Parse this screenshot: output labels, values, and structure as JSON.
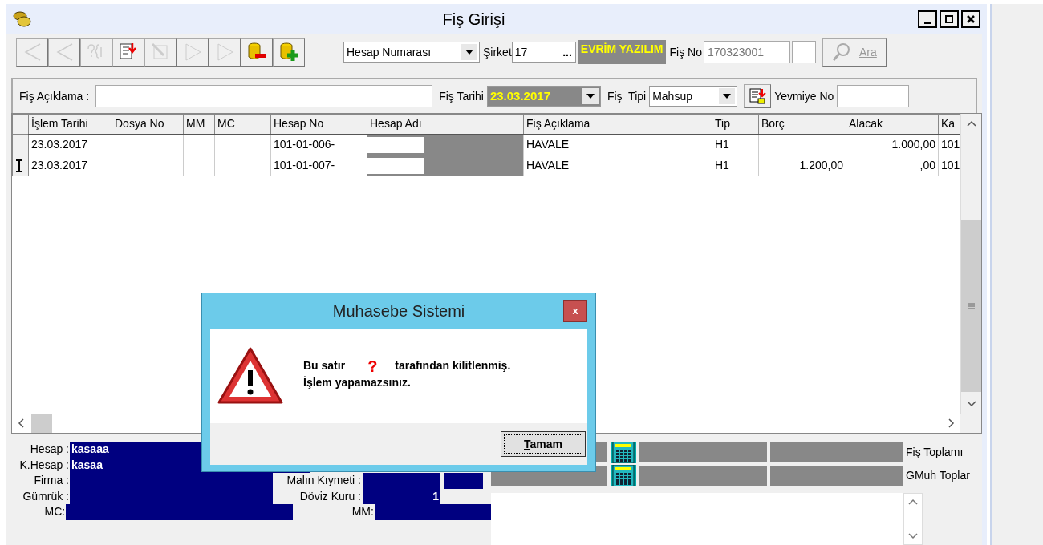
{
  "window": {
    "title": "Fiş Girişi"
  },
  "toolbar": [
    {
      "kind": "first",
      "disabled": true
    },
    {
      "kind": "prev",
      "disabled": true
    },
    {
      "kind": "query",
      "disabled": true
    },
    {
      "kind": "import",
      "disabled": false
    },
    {
      "kind": "edit",
      "disabled": true
    },
    {
      "kind": "next",
      "disabled": true
    },
    {
      "kind": "last",
      "disabled": true
    },
    {
      "kind": "remove",
      "disabled": false
    },
    {
      "kind": "add",
      "disabled": false
    }
  ],
  "search_by": {
    "value": "Hesap Numarası"
  },
  "company": {
    "label": "Şirket",
    "value": "17",
    "browse": "...",
    "name": "EVRİM YAZILIM"
  },
  "voucher_no": {
    "label": "Fiş No",
    "value": "170323001",
    "search_button": "Ara"
  },
  "description": {
    "label": "Fiş Açıklama :"
  },
  "date": {
    "label": "Fiş Tarihi",
    "value": "23.03.2017"
  },
  "type": {
    "label": "Fiş  Tipi",
    "value": "Mahsup"
  },
  "journal_no": {
    "label": "Yevmiye No"
  },
  "table": {
    "columns": [
      "İşlem Tarihi",
      "Dosya No",
      "MM",
      "MC",
      "Hesap No",
      "Hesap Adı",
      "Fiş Açıklama",
      "Tip",
      "Borç",
      "Alacak",
      "Ka"
    ],
    "rows": [
      {
        "selected": false,
        "cells": [
          "23.03.2017",
          "",
          "",
          "",
          "101-01-006-",
          "",
          "HAVALE",
          "H1",
          "",
          "1.000,00",
          "101"
        ]
      },
      {
        "selected": true,
        "cells": [
          "23.03.2017",
          "",
          "",
          "",
          "101-01-007-",
          "",
          "HAVALE",
          "H1",
          "1.200,00",
          ",00",
          "101"
        ]
      }
    ]
  },
  "info_left": [
    {
      "label": "Hesap :",
      "value": "kasaaa"
    },
    {
      "label": "K.Hesap :",
      "value": "kasaa"
    },
    {
      "label": "Firma :"
    },
    {
      "label": "Gümrük :"
    },
    {
      "label": "MC:"
    }
  ],
  "info_right": [
    {
      "label": "Malın Kıymeti :"
    },
    {
      "label": "Döviz Kuru :",
      "value": "1"
    },
    {
      "label": "MM:"
    }
  ],
  "totals": [
    {
      "label": "Fiş Toplamı"
    },
    {
      "label": "GMuh Toplar"
    }
  ],
  "dialog": {
    "title": "Muhasebe Sistemi",
    "close": "x",
    "message_before": "Bu satır",
    "marker": "?",
    "message_after": "tarafından kilitlenmiş.",
    "message_line2": "İşlem yapamazsınız.",
    "button": "Tamam"
  }
}
